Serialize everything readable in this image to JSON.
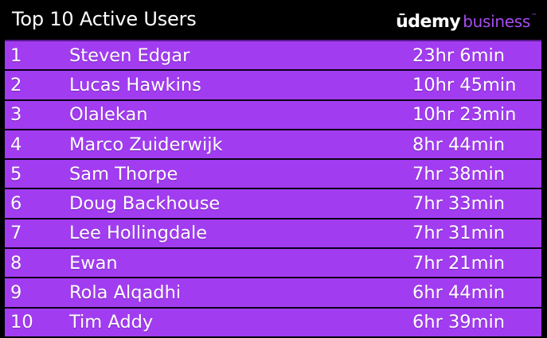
{
  "header": {
    "title": "Top 10 Active Users",
    "logo_primary": "ūdemy",
    "logo_secondary": "business",
    "logo_tm": "™"
  },
  "colors": {
    "background": "#000000",
    "row_fill": "#a23cf1",
    "logo_accent": "#a64cf0",
    "text": "#ffffff"
  },
  "rows": [
    {
      "rank": "1",
      "name": "Steven Edgar",
      "time": "23hr 6min"
    },
    {
      "rank": "2",
      "name": "Lucas Hawkins",
      "time": "10hr 45min"
    },
    {
      "rank": "3",
      "name": "Olalekan",
      "time": "10hr 23min"
    },
    {
      "rank": "4",
      "name": "Marco Zuiderwijk",
      "time": "8hr 44min"
    },
    {
      "rank": "5",
      "name": "Sam Thorpe",
      "time": "7hr 38min"
    },
    {
      "rank": "6",
      "name": "Doug Backhouse",
      "time": "7hr 33min"
    },
    {
      "rank": "7",
      "name": "Lee Hollingdale",
      "time": "7hr 31min"
    },
    {
      "rank": "8",
      "name": "Ewan",
      "time": "7hr 21min"
    },
    {
      "rank": "9",
      "name": "Rola Alqadhi",
      "time": "6hr 44min"
    },
    {
      "rank": "10",
      "name": "Tim Addy",
      "time": "6hr 39min"
    }
  ]
}
